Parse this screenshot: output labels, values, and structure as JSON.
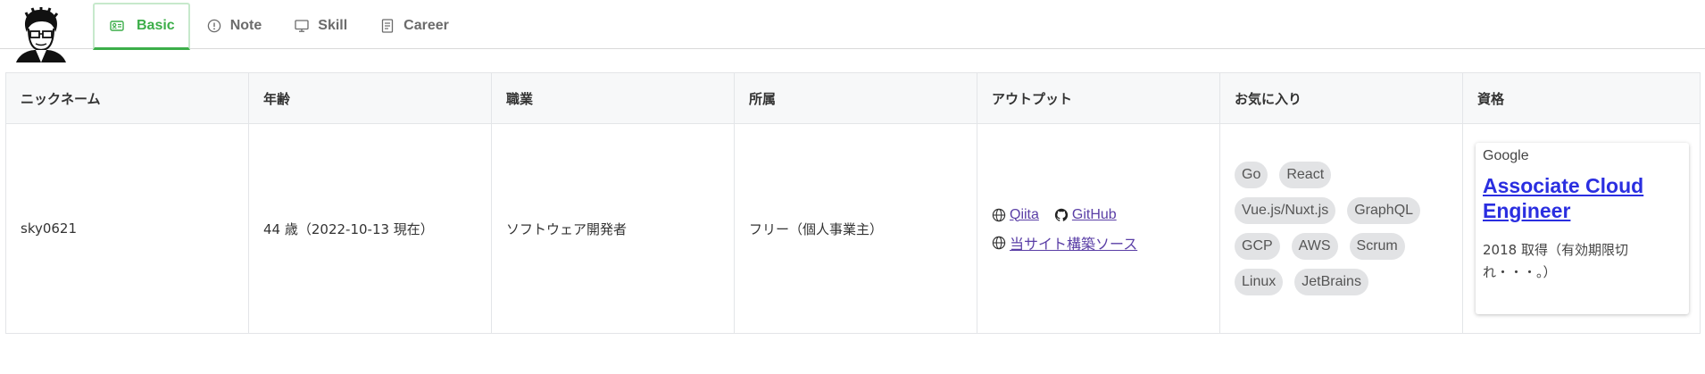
{
  "header": {
    "tabs": [
      {
        "label": "Basic",
        "icon": "id-card-icon",
        "active": true
      },
      {
        "label": "Note",
        "icon": "info-circle-icon",
        "active": false
      },
      {
        "label": "Skill",
        "icon": "monitor-icon",
        "active": false
      },
      {
        "label": "Career",
        "icon": "document-icon",
        "active": false
      }
    ],
    "accent_color": "#3cae49"
  },
  "table": {
    "headers": [
      "ニックネーム",
      "年齢",
      "職業",
      "所属",
      "アウトプット",
      "お気に入り",
      "資格"
    ],
    "row": {
      "nickname": "sky0621",
      "age": "44 歳（2022-10-13 現在）",
      "job": "ソフトウェア開発者",
      "affiliation": "フリー（個人事業主）",
      "outputs": [
        {
          "label": "Qiita",
          "icon": "globe-icon"
        },
        {
          "label": "GitHub",
          "icon": "github-icon"
        },
        {
          "label": "当サイト構築ソース",
          "icon": "globe-icon"
        }
      ],
      "favorites": [
        "Go",
        "React",
        "Vue.js/Nuxt.js",
        "GraphQL",
        "GCP",
        "AWS",
        "Scrum",
        "Linux",
        "JetBrains"
      ],
      "certification": {
        "provider": "Google",
        "name": "Associate Cloud Engineer",
        "note": "2018 取得（有効期限切れ・・・。）"
      }
    }
  },
  "colors": {
    "link": "#5a3ea6",
    "cert_link": "#2a2ee0",
    "chip_bg": "#e2e3e5"
  }
}
